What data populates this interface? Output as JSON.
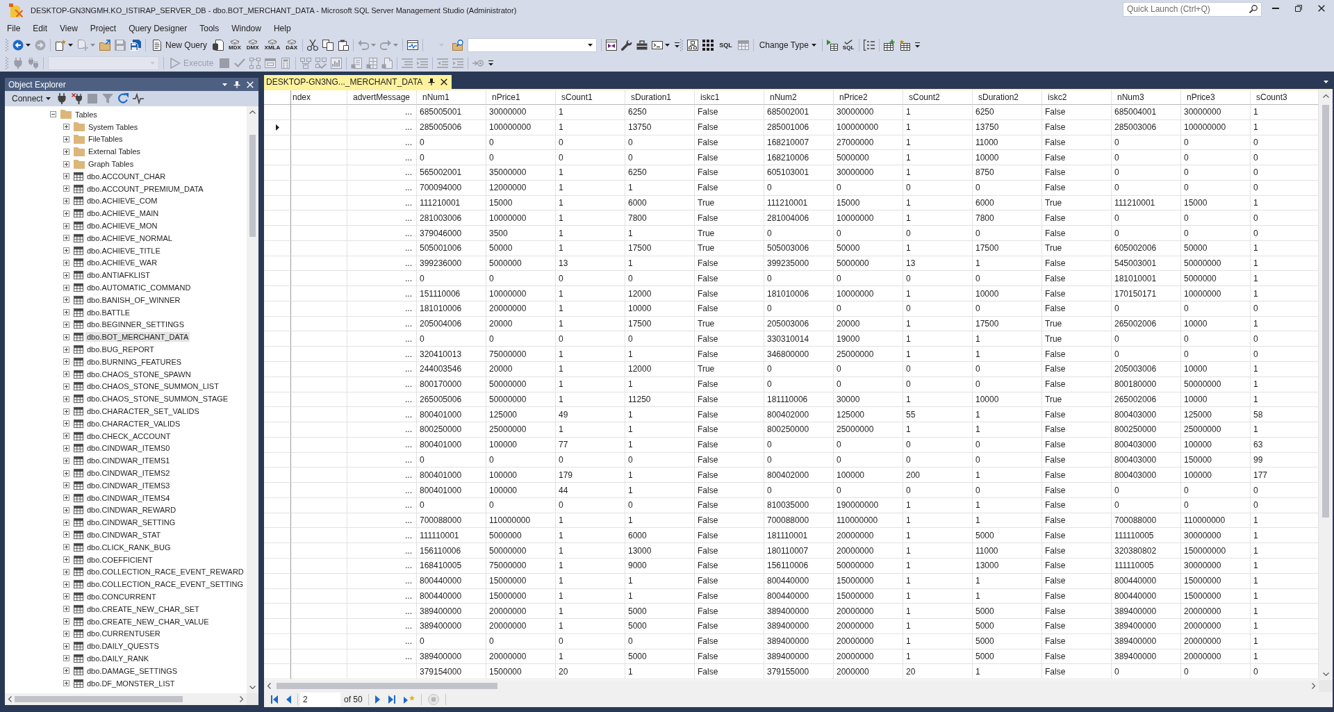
{
  "window": {
    "title": "DESKTOP-GN3NGMH.KO_ISTIRAP_SERVER_DB - dbo.BOT_MERCHANT_DATA - Microsoft SQL Server Management Studio (Administrator)",
    "quick_launch": {
      "placeholder": "Quick Launch (Ctrl+Q)"
    }
  },
  "menu": [
    "File",
    "Edit",
    "View",
    "Project",
    "Query Designer",
    "Tools",
    "Window",
    "Help"
  ],
  "toolbar_rows": [
    [
      {
        "groups": [
          [
            {
              "kind": "split",
              "disabled": false
            },
            {
              "kind": "icon",
              "disabled": true
            }
          ],
          [
            {
              "kind": "split",
              "disabled": false
            },
            {
              "kind": "split",
              "disabled": true
            },
            {
              "kind": "icon",
              "disabled": false
            },
            {
              "kind": "icon",
              "disabled": true
            },
            {
              "kind": "icon",
              "disabled": false
            }
          ],
          [
            {
              "kind": "button",
              "label": "New Query",
              "disabled": false
            },
            {
              "kind": "icon",
              "disabled": false
            },
            {
              "kind": "captioned",
              "caption": "MDX",
              "disabled": false
            },
            {
              "kind": "captioned",
              "caption": "DMX",
              "disabled": false
            },
            {
              "kind": "captioned",
              "caption": "XMLA",
              "disabled": false
            },
            {
              "kind": "captioned",
              "caption": "DAX",
              "disabled": false
            }
          ],
          [
            {
              "kind": "icon",
              "disabled": false
            },
            {
              "kind": "icon",
              "disabled": false
            },
            {
              "kind": "icon",
              "disabled": false
            }
          ],
          [
            {
              "kind": "split",
              "disabled": true
            },
            {
              "kind": "split",
              "disabled": true
            }
          ],
          [
            {
              "kind": "icon",
              "disabled": false
            }
          ],
          [
            {
              "kind": "mini-combo",
              "disabled": true
            },
            {
              "kind": "icon",
              "disabled": false
            },
            {
              "kind": "combo",
              "disabled": false
            }
          ],
          [
            {
              "kind": "icon",
              "disabled": false
            },
            {
              "kind": "icon",
              "disabled": false
            },
            {
              "kind": "icon",
              "disabled": false
            },
            {
              "kind": "split",
              "disabled": false
            }
          ]
        ],
        "overflow": true
      },
      {
        "groups": [
          [
            {
              "kind": "icon",
              "disabled": false
            },
            {
              "kind": "icon",
              "disabled": false
            },
            {
              "kind": "text-button",
              "label": "SQL",
              "disabled": false
            },
            {
              "kind": "icon",
              "disabled": true
            }
          ],
          [
            {
              "kind": "menu-button",
              "label": "Change Type",
              "disabled": false
            }
          ],
          [
            {
              "kind": "icon",
              "disabled": false
            },
            {
              "kind": "captioned",
              "caption": "SQL",
              "disabled": false
            }
          ],
          [
            {
              "kind": "icon",
              "disabled": false
            }
          ],
          [
            {
              "kind": "icon",
              "disabled": false
            },
            {
              "kind": "icon",
              "disabled": false
            }
          ]
        ],
        "overflow": true
      }
    ],
    [
      {
        "groups": [
          [
            {
              "kind": "icon",
              "disabled": true
            },
            {
              "kind": "icon",
              "disabled": true
            }
          ],
          [
            {
              "kind": "combo",
              "disabled": true
            }
          ],
          [
            {
              "kind": "button",
              "label": "Execute",
              "disabled": true
            },
            {
              "kind": "icon",
              "disabled": true
            },
            {
              "kind": "icon",
              "disabled": true
            },
            {
              "kind": "icon",
              "disabled": true
            },
            {
              "kind": "icon",
              "disabled": true
            },
            {
              "kind": "icon",
              "disabled": true
            }
          ],
          [
            {
              "kind": "icon",
              "disabled": true
            },
            {
              "kind": "icon",
              "disabled": true
            },
            {
              "kind": "icon",
              "disabled": true
            }
          ],
          [
            {
              "kind": "icon",
              "disabled": true
            },
            {
              "kind": "icon",
              "disabled": true
            },
            {
              "kind": "icon",
              "disabled": true
            }
          ],
          [
            {
              "kind": "icon",
              "disabled": true
            },
            {
              "kind": "icon",
              "disabled": true
            }
          ],
          [
            {
              "kind": "icon",
              "disabled": true
            },
            {
              "kind": "icon",
              "disabled": true
            }
          ],
          [
            {
              "kind": "icon",
              "disabled": true
            }
          ]
        ],
        "overflow": true
      }
    ]
  ],
  "object_explorer": {
    "title": "Object Explorer",
    "toolbar": [
      {
        "kind": "menu-button",
        "label": "Connect",
        "disabled": false
      },
      {
        "kind": "icon",
        "disabled": false
      },
      {
        "kind": "icon",
        "disabled": false
      },
      {
        "kind": "icon",
        "disabled": true
      },
      {
        "kind": "icon",
        "disabled": true
      },
      {
        "kind": "icon",
        "disabled": false
      },
      {
        "kind": "icon",
        "disabled": false
      }
    ],
    "tree": [
      {
        "label": "Tables",
        "kind": "folder",
        "expanded": true,
        "selected": false,
        "children": [
          {
            "label": "System Tables",
            "kind": "folder",
            "expanded": false,
            "selected": false
          },
          {
            "label": "FileTables",
            "kind": "folder",
            "expanded": false,
            "selected": false
          },
          {
            "label": "External Tables",
            "kind": "folder",
            "expanded": false,
            "selected": false
          },
          {
            "label": "Graph Tables",
            "kind": "folder",
            "expanded": false,
            "selected": false
          },
          {
            "label": "dbo.ACCOUNT_CHAR",
            "kind": "table",
            "expanded": false,
            "selected": false
          },
          {
            "label": "dbo.ACCOUNT_PREMIUM_DATA",
            "kind": "table",
            "expanded": false,
            "selected": false
          },
          {
            "label": "dbo.ACHIEVE_COM",
            "kind": "table",
            "expanded": false,
            "selected": false
          },
          {
            "label": "dbo.ACHIEVE_MAIN",
            "kind": "table",
            "expanded": false,
            "selected": false
          },
          {
            "label": "dbo.ACHIEVE_MON",
            "kind": "table",
            "expanded": false,
            "selected": false
          },
          {
            "label": "dbo.ACHIEVE_NORMAL",
            "kind": "table",
            "expanded": false,
            "selected": false
          },
          {
            "label": "dbo.ACHIEVE_TITLE",
            "kind": "table",
            "expanded": false,
            "selected": false
          },
          {
            "label": "dbo.ACHIEVE_WAR",
            "kind": "table",
            "expanded": false,
            "selected": false
          },
          {
            "label": "dbo.ANTIAFKLIST",
            "kind": "table",
            "expanded": false,
            "selected": false
          },
          {
            "label": "dbo.AUTOMATIC_COMMAND",
            "kind": "table",
            "expanded": false,
            "selected": false
          },
          {
            "label": "dbo.BANISH_OF_WINNER",
            "kind": "table",
            "expanded": false,
            "selected": false
          },
          {
            "label": "dbo.BATTLE",
            "kind": "table",
            "expanded": false,
            "selected": false
          },
          {
            "label": "dbo.BEGINNER_SETTINGS",
            "kind": "table",
            "expanded": false,
            "selected": false
          },
          {
            "label": "dbo.BOT_MERCHANT_DATA",
            "kind": "table",
            "expanded": false,
            "selected": true
          },
          {
            "label": "dbo.BUG_REPORT",
            "kind": "table",
            "expanded": false,
            "selected": false
          },
          {
            "label": "dbo.BURNING_FEATURES",
            "kind": "table",
            "expanded": false,
            "selected": false
          },
          {
            "label": "dbo.CHAOS_STONE_SPAWN",
            "kind": "table",
            "expanded": false,
            "selected": false
          },
          {
            "label": "dbo.CHAOS_STONE_SUMMON_LIST",
            "kind": "table",
            "expanded": false,
            "selected": false
          },
          {
            "label": "dbo.CHAOS_STONE_SUMMON_STAGE",
            "kind": "table",
            "expanded": false,
            "selected": false
          },
          {
            "label": "dbo.CHARACTER_SET_VALIDS",
            "kind": "table",
            "expanded": false,
            "selected": false
          },
          {
            "label": "dbo.CHARACTER_VALIDS",
            "kind": "table",
            "expanded": false,
            "selected": false
          },
          {
            "label": "dbo.CHECK_ACCOUNT",
            "kind": "table",
            "expanded": false,
            "selected": false
          },
          {
            "label": "dbo.CINDWAR_ITEMS0",
            "kind": "table",
            "expanded": false,
            "selected": false
          },
          {
            "label": "dbo.CINDWAR_ITEMS1",
            "kind": "table",
            "expanded": false,
            "selected": false
          },
          {
            "label": "dbo.CINDWAR_ITEMS2",
            "kind": "table",
            "expanded": false,
            "selected": false
          },
          {
            "label": "dbo.CINDWAR_ITEMS3",
            "kind": "table",
            "expanded": false,
            "selected": false
          },
          {
            "label": "dbo.CINDWAR_ITEMS4",
            "kind": "table",
            "expanded": false,
            "selected": false
          },
          {
            "label": "dbo.CINDWAR_REWARD",
            "kind": "table",
            "expanded": false,
            "selected": false
          },
          {
            "label": "dbo.CINDWAR_SETTING",
            "kind": "table",
            "expanded": false,
            "selected": false
          },
          {
            "label": "dbo.CINDWAR_STAT",
            "kind": "table",
            "expanded": false,
            "selected": false
          },
          {
            "label": "dbo.CLICK_RANK_BUG",
            "kind": "table",
            "expanded": false,
            "selected": false
          },
          {
            "label": "dbo.COEFFICIENT",
            "kind": "table",
            "expanded": false,
            "selected": false
          },
          {
            "label": "dbo.COLLECTION_RACE_EVENT_REWARD",
            "kind": "table",
            "expanded": false,
            "selected": false
          },
          {
            "label": "dbo.COLLECTION_RACE_EVENT_SETTING",
            "kind": "table",
            "expanded": false,
            "selected": false
          },
          {
            "label": "dbo.CONCURRENT",
            "kind": "table",
            "expanded": false,
            "selected": false
          },
          {
            "label": "dbo.CREATE_NEW_CHAR_SET",
            "kind": "table",
            "expanded": false,
            "selected": false
          },
          {
            "label": "dbo.CREATE_NEW_CHAR_VALUE",
            "kind": "table",
            "expanded": false,
            "selected": false
          },
          {
            "label": "dbo.CURRENTUSER",
            "kind": "table",
            "expanded": false,
            "selected": false
          },
          {
            "label": "dbo.DAILY_QUESTS",
            "kind": "table",
            "expanded": false,
            "selected": false
          },
          {
            "label": "dbo.DAILY_RANK",
            "kind": "table",
            "expanded": false,
            "selected": false
          },
          {
            "label": "dbo.DAMAGE_SETTINGS",
            "kind": "table",
            "expanded": false,
            "selected": false
          },
          {
            "label": "dbo.DF_MONSTER_LIST",
            "kind": "table",
            "expanded": false,
            "selected": false
          }
        ]
      }
    ]
  },
  "document": {
    "tabs": [
      {
        "label": "DESKTOP-GN3NG..._MERCHANT_DATA",
        "selected": true
      }
    ],
    "grid": {
      "columns": [
        {
          "label": "ndex",
          "kind": "value"
        },
        {
          "label": "advertMessage",
          "kind": "text"
        },
        {
          "label": "nNum1",
          "kind": "value"
        },
        {
          "label": "nPrice1",
          "kind": "value"
        },
        {
          "label": "sCount1",
          "kind": "value"
        },
        {
          "label": "sDuration1",
          "kind": "value"
        },
        {
          "label": "iskc1",
          "kind": "value"
        },
        {
          "label": "nNum2",
          "kind": "value"
        },
        {
          "label": "nPrice2",
          "kind": "value"
        },
        {
          "label": "sCount2",
          "kind": "value"
        },
        {
          "label": "sDuration2",
          "kind": "value"
        },
        {
          "label": "iskc2",
          "kind": "value"
        },
        {
          "label": "nNum3",
          "kind": "value"
        },
        {
          "label": "nPrice3",
          "kind": "value"
        },
        {
          "label": "sCount3",
          "kind": "value"
        }
      ],
      "rows": [
        {
          "selected": false,
          "cells": [
            "",
            "...",
            "685005001",
            "30000000",
            "1",
            "6250",
            "False",
            "685002001",
            "30000000",
            "1",
            "6250",
            "False",
            "685004001",
            "30000000",
            "1"
          ]
        },
        {
          "selected": true,
          "cells": [
            "",
            "...",
            "285005006",
            "100000000",
            "1",
            "13750",
            "False",
            "285001006",
            "100000000",
            "1",
            "13750",
            "False",
            "285003006",
            "100000000",
            "1"
          ]
        },
        {
          "selected": false,
          "cells": [
            "",
            "...",
            "0",
            "0",
            "0",
            "0",
            "False",
            "168210007",
            "27000000",
            "1",
            "11000",
            "False",
            "0",
            "0",
            "0"
          ]
        },
        {
          "selected": false,
          "cells": [
            "",
            "...",
            "0",
            "0",
            "0",
            "0",
            "False",
            "168210006",
            "5000000",
            "1",
            "10000",
            "False",
            "0",
            "0",
            "0"
          ]
        },
        {
          "selected": false,
          "cells": [
            "",
            "...",
            "565002001",
            "35000000",
            "1",
            "6250",
            "False",
            "605103001",
            "30000000",
            "1",
            "8750",
            "False",
            "0",
            "0",
            "0"
          ]
        },
        {
          "selected": false,
          "cells": [
            "",
            "...",
            "700094000",
            "12000000",
            "1",
            "1",
            "False",
            "0",
            "0",
            "0",
            "0",
            "False",
            "0",
            "0",
            "0"
          ]
        },
        {
          "selected": false,
          "cells": [
            "",
            "...",
            "111210001",
            "15000",
            "1",
            "6000",
            "True",
            "111210001",
            "15000",
            "1",
            "6000",
            "True",
            "111210001",
            "15000",
            "1"
          ]
        },
        {
          "selected": false,
          "cells": [
            "",
            "...",
            "281003006",
            "10000000",
            "1",
            "7800",
            "False",
            "281004006",
            "10000000",
            "1",
            "7800",
            "False",
            "0",
            "0",
            "0"
          ]
        },
        {
          "selected": false,
          "cells": [
            "",
            "...",
            "379046000",
            "3500",
            "1",
            "1",
            "True",
            "0",
            "0",
            "0",
            "0",
            "False",
            "0",
            "0",
            "0"
          ]
        },
        {
          "selected": false,
          "cells": [
            "",
            "...",
            "505001006",
            "50000",
            "1",
            "17500",
            "True",
            "505003006",
            "50000",
            "1",
            "17500",
            "True",
            "605002006",
            "50000",
            "1"
          ]
        },
        {
          "selected": false,
          "cells": [
            "",
            "...",
            "399236000",
            "5000000",
            "13",
            "1",
            "False",
            "399235000",
            "5000000",
            "13",
            "1",
            "False",
            "545003001",
            "50000000",
            "1"
          ]
        },
        {
          "selected": false,
          "cells": [
            "",
            "...",
            "0",
            "0",
            "0",
            "0",
            "False",
            "0",
            "0",
            "0",
            "0",
            "False",
            "181010001",
            "5000000",
            "1"
          ]
        },
        {
          "selected": false,
          "cells": [
            "",
            "...",
            "151110006",
            "10000000",
            "1",
            "12000",
            "False",
            "181010006",
            "10000000",
            "1",
            "10000",
            "False",
            "170150171",
            "10000000",
            "1"
          ]
        },
        {
          "selected": false,
          "cells": [
            "",
            "...",
            "181010006",
            "20000000",
            "1",
            "10000",
            "False",
            "0",
            "0",
            "0",
            "0",
            "False",
            "0",
            "0",
            "0"
          ]
        },
        {
          "selected": false,
          "cells": [
            "",
            "...",
            "205004006",
            "20000",
            "1",
            "17500",
            "True",
            "205003006",
            "20000",
            "1",
            "17500",
            "True",
            "265002006",
            "10000",
            "1"
          ]
        },
        {
          "selected": false,
          "cells": [
            "",
            "...",
            "0",
            "0",
            "0",
            "0",
            "False",
            "330310014",
            "19000",
            "1",
            "1",
            "True",
            "0",
            "0",
            "0"
          ]
        },
        {
          "selected": false,
          "cells": [
            "",
            "...",
            "320410013",
            "75000000",
            "1",
            "1",
            "False",
            "346800000",
            "25000000",
            "1",
            "1",
            "False",
            "0",
            "0",
            "0"
          ]
        },
        {
          "selected": false,
          "cells": [
            "",
            "...",
            "244003546",
            "20000",
            "1",
            "12000",
            "True",
            "0",
            "0",
            "0",
            "0",
            "False",
            "205003006",
            "10000",
            "1"
          ]
        },
        {
          "selected": false,
          "cells": [
            "",
            "...",
            "800170000",
            "50000000",
            "1",
            "1",
            "False",
            "0",
            "0",
            "0",
            "0",
            "False",
            "800180000",
            "50000000",
            "1"
          ]
        },
        {
          "selected": false,
          "cells": [
            "",
            "...",
            "265005006",
            "50000000",
            "1",
            "11250",
            "False",
            "181110006",
            "30000",
            "1",
            "10000",
            "True",
            "265002006",
            "10000",
            "1"
          ]
        },
        {
          "selected": false,
          "cells": [
            "",
            "...",
            "800401000",
            "125000",
            "49",
            "1",
            "False",
            "800402000",
            "125000",
            "55",
            "1",
            "False",
            "800403000",
            "125000",
            "58"
          ]
        },
        {
          "selected": false,
          "cells": [
            "",
            "...",
            "800250000",
            "25000000",
            "1",
            "1",
            "False",
            "800250000",
            "25000000",
            "1",
            "1",
            "False",
            "800250000",
            "25000000",
            "1"
          ]
        },
        {
          "selected": false,
          "cells": [
            "",
            "...",
            "800401000",
            "100000",
            "77",
            "1",
            "False",
            "0",
            "0",
            "0",
            "0",
            "False",
            "800403000",
            "100000",
            "63"
          ]
        },
        {
          "selected": false,
          "cells": [
            "",
            "...",
            "0",
            "0",
            "0",
            "0",
            "False",
            "0",
            "0",
            "0",
            "0",
            "False",
            "800403000",
            "150000",
            "99"
          ]
        },
        {
          "selected": false,
          "cells": [
            "",
            "...",
            "800401000",
            "100000",
            "179",
            "1",
            "False",
            "800402000",
            "100000",
            "200",
            "1",
            "False",
            "800403000",
            "100000",
            "177"
          ]
        },
        {
          "selected": false,
          "cells": [
            "",
            "...",
            "800401000",
            "100000",
            "44",
            "1",
            "False",
            "0",
            "0",
            "0",
            "0",
            "False",
            "0",
            "0",
            "0"
          ]
        },
        {
          "selected": false,
          "cells": [
            "",
            "...",
            "0",
            "0",
            "0",
            "0",
            "False",
            "810035000",
            "190000000",
            "1",
            "1",
            "False",
            "0",
            "0",
            "0"
          ]
        },
        {
          "selected": false,
          "cells": [
            "",
            "...",
            "700088000",
            "110000000",
            "1",
            "1",
            "False",
            "700088000",
            "110000000",
            "1",
            "1",
            "False",
            "700088000",
            "110000000",
            "1"
          ]
        },
        {
          "selected": false,
          "cells": [
            "",
            "...",
            "111110001",
            "5000000",
            "1",
            "6000",
            "False",
            "181110001",
            "20000000",
            "1",
            "5000",
            "False",
            "111110005",
            "30000000",
            "1"
          ]
        },
        {
          "selected": false,
          "cells": [
            "",
            "...",
            "156110006",
            "50000000",
            "1",
            "13000",
            "False",
            "180110007",
            "20000000",
            "1",
            "11000",
            "False",
            "320380802",
            "150000000",
            "1"
          ]
        },
        {
          "selected": false,
          "cells": [
            "",
            "...",
            "168410005",
            "75000000",
            "1",
            "9000",
            "False",
            "156110006",
            "50000000",
            "1",
            "13000",
            "False",
            "111110005",
            "30000000",
            "1"
          ]
        },
        {
          "selected": false,
          "cells": [
            "",
            "...",
            "800440000",
            "15000000",
            "1",
            "1",
            "False",
            "800440000",
            "15000000",
            "1",
            "1",
            "False",
            "800440000",
            "15000000",
            "1"
          ]
        },
        {
          "selected": false,
          "cells": [
            "",
            "...",
            "800440000",
            "15000000",
            "1",
            "1",
            "False",
            "800440000",
            "15000000",
            "1",
            "1",
            "False",
            "800440000",
            "15000000",
            "1"
          ]
        },
        {
          "selected": false,
          "cells": [
            "",
            "...",
            "389400000",
            "20000000",
            "1",
            "5000",
            "False",
            "389400000",
            "20000000",
            "1",
            "5000",
            "False",
            "389400000",
            "20000000",
            "1"
          ]
        },
        {
          "selected": false,
          "cells": [
            "",
            "...",
            "389400000",
            "20000000",
            "1",
            "5000",
            "False",
            "389400000",
            "20000000",
            "1",
            "5000",
            "False",
            "389400000",
            "20000000",
            "1"
          ]
        },
        {
          "selected": false,
          "cells": [
            "",
            "...",
            "0",
            "0",
            "0",
            "0",
            "False",
            "389400000",
            "20000000",
            "1",
            "5000",
            "False",
            "389400000",
            "20000000",
            "1"
          ]
        },
        {
          "selected": false,
          "cells": [
            "",
            "...",
            "389400000",
            "20000000",
            "1",
            "5000",
            "False",
            "389400000",
            "20000000",
            "1",
            "5000",
            "False",
            "389400000",
            "20000000",
            "1"
          ]
        },
        {
          "selected": false,
          "cells": [
            "",
            "",
            "379154000",
            "1500000",
            "20",
            "1",
            "False",
            "379155000",
            "2000000",
            "20",
            "1",
            "False",
            "0",
            "0",
            "0"
          ]
        }
      ]
    },
    "navigator": {
      "controls": [
        {
          "kind": "button",
          "disabled": false
        },
        {
          "kind": "button",
          "disabled": false
        },
        {
          "kind": "separator"
        },
        {
          "kind": "page-field",
          "value": "2"
        },
        {
          "kind": "label",
          "text": "of 50"
        },
        {
          "kind": "separator"
        },
        {
          "kind": "button",
          "disabled": false
        },
        {
          "kind": "button",
          "disabled": false
        },
        {
          "kind": "button",
          "disabled": false
        },
        {
          "kind": "separator"
        },
        {
          "kind": "button",
          "disabled": true
        },
        {
          "kind": "separator"
        }
      ]
    }
  }
}
